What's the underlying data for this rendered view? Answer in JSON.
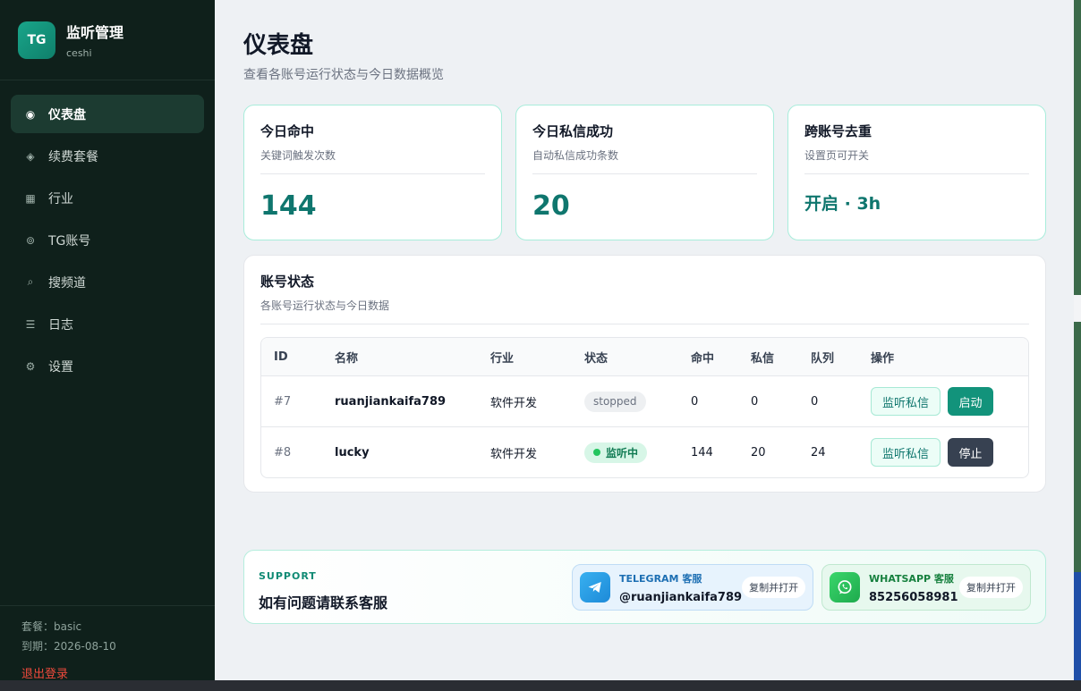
{
  "brand": {
    "logo": "TG",
    "title": "监听管理",
    "subtitle": "ceshi"
  },
  "nav": [
    {
      "label": "仪表盘",
      "icon": "radio-dot-icon",
      "active": true
    },
    {
      "label": "续费套餐",
      "icon": "diamond-icon"
    },
    {
      "label": "行业",
      "icon": "grid-icon"
    },
    {
      "label": "TG账号",
      "icon": "ring-icon"
    },
    {
      "label": "搜频道",
      "icon": "search-icon"
    },
    {
      "label": "日志",
      "icon": "list-icon"
    },
    {
      "label": "设置",
      "icon": "gear-icon"
    }
  ],
  "footer": {
    "plan": "套餐：basic",
    "expiry": "到期：2026-08-10",
    "logout": "退出登录"
  },
  "page": {
    "title": "仪表盘",
    "subtitle": "查看各账号运行状态与今日数据概览"
  },
  "stats": [
    {
      "title": "今日命中",
      "sub": "关键词触发次数",
      "value": "144"
    },
    {
      "title": "今日私信成功",
      "sub": "自动私信成功条数",
      "value": "20"
    },
    {
      "title": "跨账号去重",
      "sub": "设置页可开关",
      "value": "开启 · 3h"
    }
  ],
  "accounts": {
    "title": "账号状态",
    "subtitle": "各账号运行状态与今日数据",
    "columns": [
      "ID",
      "名称",
      "行业",
      "状态",
      "命中",
      "私信",
      "队列",
      "操作"
    ],
    "rows": [
      {
        "id": "#7",
        "name": "ruanjiankaifa789",
        "industry": "软件开发",
        "status": "stopped",
        "hits": "0",
        "pm": "0",
        "queue": "0",
        "btn1": "监听私信",
        "btn2": "启动"
      },
      {
        "id": "#8",
        "name": "lucky",
        "industry": "软件开发",
        "status": "监听中",
        "hits": "144",
        "pm": "20",
        "queue": "24",
        "btn1": "监听私信",
        "btn2": "停止"
      }
    ]
  },
  "support": {
    "label": "SUPPORT",
    "title": "如有问题请联系客服",
    "telegram": {
      "label": "TELEGRAM 客服",
      "value": "@ruanjiankaifa789",
      "copy": "复制并打开",
      "icon": "telegram-icon"
    },
    "whatsapp": {
      "label": "WHATSAPP 客服",
      "value": "85256058981",
      "copy": "复制并打开",
      "icon": "whatsapp-icon"
    }
  },
  "colors": {
    "accent": "#0f766e",
    "sidebar": "#0f201b",
    "live": "#22c55e",
    "danger": "#ef4a3c"
  }
}
